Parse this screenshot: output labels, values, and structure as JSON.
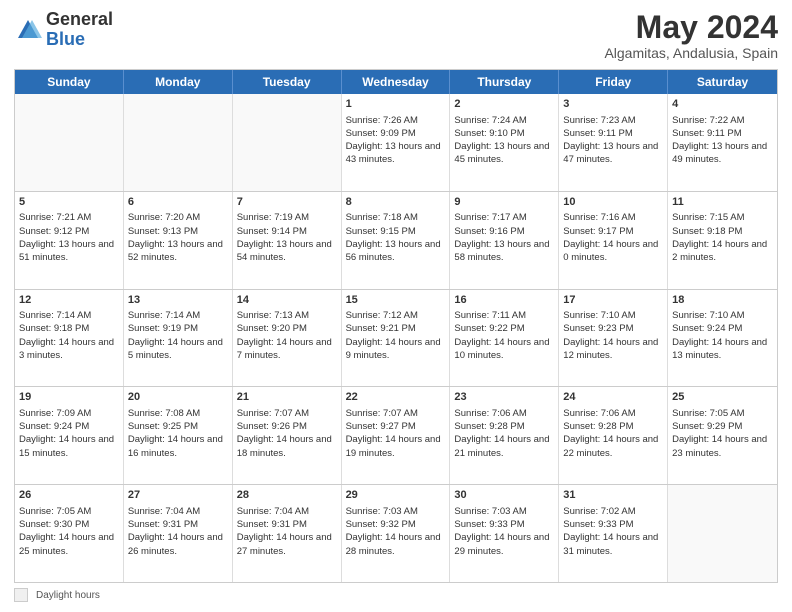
{
  "logo": {
    "general": "General",
    "blue": "Blue"
  },
  "title": "May 2024",
  "subtitle": "Algamitas, Andalusia, Spain",
  "days": [
    "Sunday",
    "Monday",
    "Tuesday",
    "Wednesday",
    "Thursday",
    "Friday",
    "Saturday"
  ],
  "weeks": [
    [
      {
        "num": "",
        "sunrise": "",
        "sunset": "",
        "daylight": "",
        "empty": true
      },
      {
        "num": "",
        "sunrise": "",
        "sunset": "",
        "daylight": "",
        "empty": true
      },
      {
        "num": "",
        "sunrise": "",
        "sunset": "",
        "daylight": "",
        "empty": true
      },
      {
        "num": "1",
        "sunrise": "Sunrise: 7:26 AM",
        "sunset": "Sunset: 9:09 PM",
        "daylight": "Daylight: 13 hours and 43 minutes."
      },
      {
        "num": "2",
        "sunrise": "Sunrise: 7:24 AM",
        "sunset": "Sunset: 9:10 PM",
        "daylight": "Daylight: 13 hours and 45 minutes."
      },
      {
        "num": "3",
        "sunrise": "Sunrise: 7:23 AM",
        "sunset": "Sunset: 9:11 PM",
        "daylight": "Daylight: 13 hours and 47 minutes."
      },
      {
        "num": "4",
        "sunrise": "Sunrise: 7:22 AM",
        "sunset": "Sunset: 9:11 PM",
        "daylight": "Daylight: 13 hours and 49 minutes."
      }
    ],
    [
      {
        "num": "5",
        "sunrise": "Sunrise: 7:21 AM",
        "sunset": "Sunset: 9:12 PM",
        "daylight": "Daylight: 13 hours and 51 minutes."
      },
      {
        "num": "6",
        "sunrise": "Sunrise: 7:20 AM",
        "sunset": "Sunset: 9:13 PM",
        "daylight": "Daylight: 13 hours and 52 minutes."
      },
      {
        "num": "7",
        "sunrise": "Sunrise: 7:19 AM",
        "sunset": "Sunset: 9:14 PM",
        "daylight": "Daylight: 13 hours and 54 minutes."
      },
      {
        "num": "8",
        "sunrise": "Sunrise: 7:18 AM",
        "sunset": "Sunset: 9:15 PM",
        "daylight": "Daylight: 13 hours and 56 minutes."
      },
      {
        "num": "9",
        "sunrise": "Sunrise: 7:17 AM",
        "sunset": "Sunset: 9:16 PM",
        "daylight": "Daylight: 13 hours and 58 minutes."
      },
      {
        "num": "10",
        "sunrise": "Sunrise: 7:16 AM",
        "sunset": "Sunset: 9:17 PM",
        "daylight": "Daylight: 14 hours and 0 minutes."
      },
      {
        "num": "11",
        "sunrise": "Sunrise: 7:15 AM",
        "sunset": "Sunset: 9:18 PM",
        "daylight": "Daylight: 14 hours and 2 minutes."
      }
    ],
    [
      {
        "num": "12",
        "sunrise": "Sunrise: 7:14 AM",
        "sunset": "Sunset: 9:18 PM",
        "daylight": "Daylight: 14 hours and 3 minutes."
      },
      {
        "num": "13",
        "sunrise": "Sunrise: 7:14 AM",
        "sunset": "Sunset: 9:19 PM",
        "daylight": "Daylight: 14 hours and 5 minutes."
      },
      {
        "num": "14",
        "sunrise": "Sunrise: 7:13 AM",
        "sunset": "Sunset: 9:20 PM",
        "daylight": "Daylight: 14 hours and 7 minutes."
      },
      {
        "num": "15",
        "sunrise": "Sunrise: 7:12 AM",
        "sunset": "Sunset: 9:21 PM",
        "daylight": "Daylight: 14 hours and 9 minutes."
      },
      {
        "num": "16",
        "sunrise": "Sunrise: 7:11 AM",
        "sunset": "Sunset: 9:22 PM",
        "daylight": "Daylight: 14 hours and 10 minutes."
      },
      {
        "num": "17",
        "sunrise": "Sunrise: 7:10 AM",
        "sunset": "Sunset: 9:23 PM",
        "daylight": "Daylight: 14 hours and 12 minutes."
      },
      {
        "num": "18",
        "sunrise": "Sunrise: 7:10 AM",
        "sunset": "Sunset: 9:24 PM",
        "daylight": "Daylight: 14 hours and 13 minutes."
      }
    ],
    [
      {
        "num": "19",
        "sunrise": "Sunrise: 7:09 AM",
        "sunset": "Sunset: 9:24 PM",
        "daylight": "Daylight: 14 hours and 15 minutes."
      },
      {
        "num": "20",
        "sunrise": "Sunrise: 7:08 AM",
        "sunset": "Sunset: 9:25 PM",
        "daylight": "Daylight: 14 hours and 16 minutes."
      },
      {
        "num": "21",
        "sunrise": "Sunrise: 7:07 AM",
        "sunset": "Sunset: 9:26 PM",
        "daylight": "Daylight: 14 hours and 18 minutes."
      },
      {
        "num": "22",
        "sunrise": "Sunrise: 7:07 AM",
        "sunset": "Sunset: 9:27 PM",
        "daylight": "Daylight: 14 hours and 19 minutes."
      },
      {
        "num": "23",
        "sunrise": "Sunrise: 7:06 AM",
        "sunset": "Sunset: 9:28 PM",
        "daylight": "Daylight: 14 hours and 21 minutes."
      },
      {
        "num": "24",
        "sunrise": "Sunrise: 7:06 AM",
        "sunset": "Sunset: 9:28 PM",
        "daylight": "Daylight: 14 hours and 22 minutes."
      },
      {
        "num": "25",
        "sunrise": "Sunrise: 7:05 AM",
        "sunset": "Sunset: 9:29 PM",
        "daylight": "Daylight: 14 hours and 23 minutes."
      }
    ],
    [
      {
        "num": "26",
        "sunrise": "Sunrise: 7:05 AM",
        "sunset": "Sunset: 9:30 PM",
        "daylight": "Daylight: 14 hours and 25 minutes."
      },
      {
        "num": "27",
        "sunrise": "Sunrise: 7:04 AM",
        "sunset": "Sunset: 9:31 PM",
        "daylight": "Daylight: 14 hours and 26 minutes."
      },
      {
        "num": "28",
        "sunrise": "Sunrise: 7:04 AM",
        "sunset": "Sunset: 9:31 PM",
        "daylight": "Daylight: 14 hours and 27 minutes."
      },
      {
        "num": "29",
        "sunrise": "Sunrise: 7:03 AM",
        "sunset": "Sunset: 9:32 PM",
        "daylight": "Daylight: 14 hours and 28 minutes."
      },
      {
        "num": "30",
        "sunrise": "Sunrise: 7:03 AM",
        "sunset": "Sunset: 9:33 PM",
        "daylight": "Daylight: 14 hours and 29 minutes."
      },
      {
        "num": "31",
        "sunrise": "Sunrise: 7:02 AM",
        "sunset": "Sunset: 9:33 PM",
        "daylight": "Daylight: 14 hours and 31 minutes."
      },
      {
        "num": "",
        "sunrise": "",
        "sunset": "",
        "daylight": "",
        "empty": true
      }
    ]
  ],
  "footer": {
    "legend_label": "Daylight hours"
  }
}
